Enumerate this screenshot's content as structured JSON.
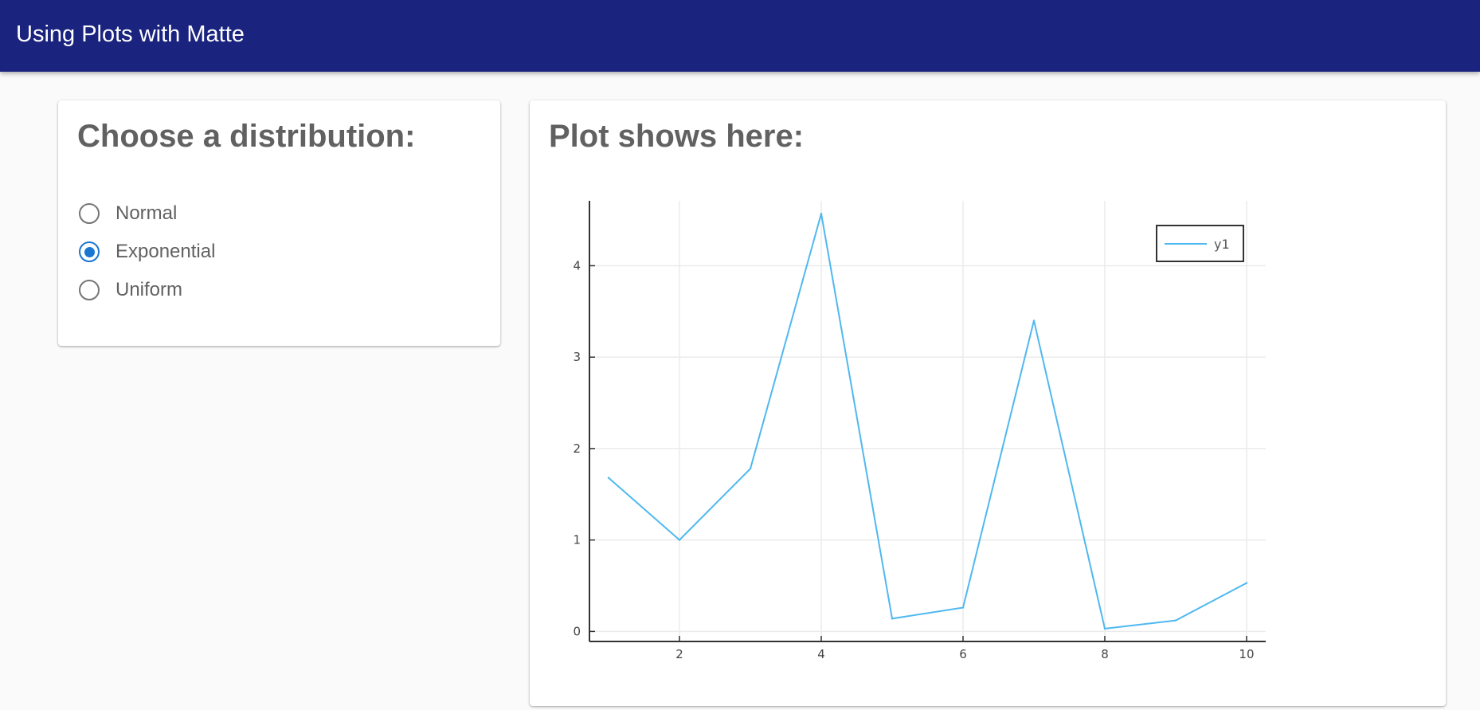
{
  "app_bar": {
    "title": "Using Plots with Matte",
    "background": "#1a237e"
  },
  "distribution_card": {
    "heading": "Choose a distribution:",
    "options": [
      {
        "label": "Normal",
        "selected": false
      },
      {
        "label": "Exponential",
        "selected": true
      },
      {
        "label": "Uniform",
        "selected": false
      }
    ],
    "accent": "#1976d2"
  },
  "plot_card": {
    "heading": "Plot shows here:"
  },
  "chart_data": {
    "type": "line",
    "x": [
      1,
      2,
      3,
      4,
      5,
      6,
      7,
      8,
      9,
      10
    ],
    "series": [
      {
        "name": "y1",
        "values": [
          1.68,
          1.0,
          1.78,
          4.57,
          0.14,
          0.26,
          3.4,
          0.03,
          0.12,
          0.53
        ],
        "color": "#4fb8f0"
      }
    ],
    "xticks": [
      "2",
      "4",
      "6",
      "8",
      "10"
    ],
    "yticks": [
      "0",
      "1",
      "2",
      "3",
      "4"
    ],
    "xlim": [
      0.73,
      10.27
    ],
    "ylim": [
      -0.11,
      4.71
    ],
    "grid": true,
    "legend_position": "top-right",
    "title": "",
    "xlabel": "",
    "ylabel": ""
  }
}
